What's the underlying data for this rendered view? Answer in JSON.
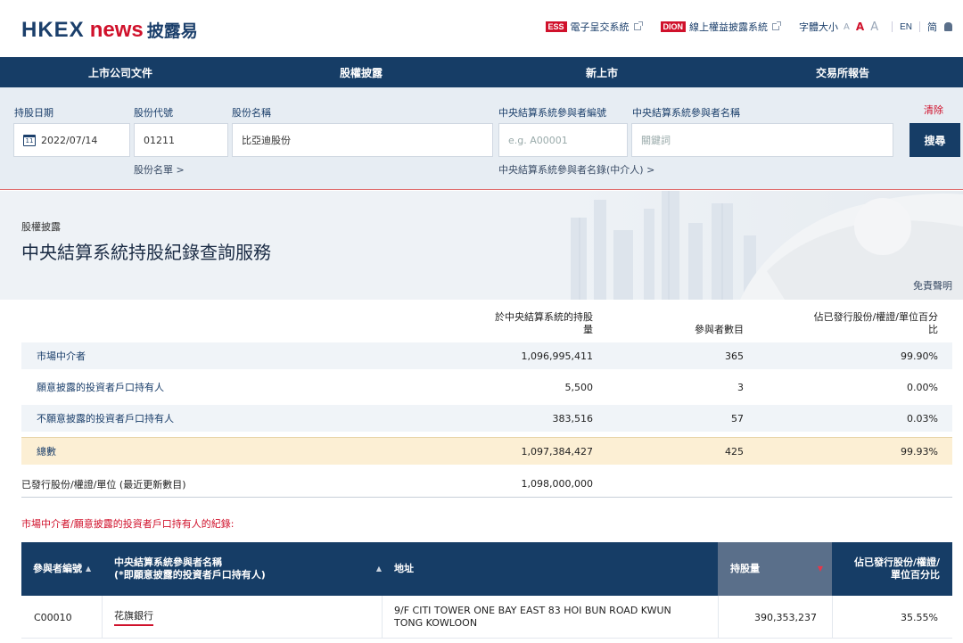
{
  "header": {
    "logo_hkex": "HKEX",
    "logo_news": "news",
    "logo_zh": "披露易",
    "ess_badge": "ESS",
    "ess_label": "電子呈交系統",
    "dion_badge": "DION",
    "dion_label": "線上權益披露系統",
    "font_size_label": "字體大小",
    "font_sizes": [
      "A",
      "A",
      "A"
    ],
    "lang_en": "EN",
    "lang_simplified": "简"
  },
  "nav": {
    "items": [
      "上市公司文件",
      "股權披露",
      "新上市",
      "交易所報告"
    ]
  },
  "search": {
    "date_label": "持股日期",
    "date_value": "2022/07/14",
    "code_label": "股份代號",
    "code_value": "01211",
    "name_label": "股份名稱",
    "name_value": "比亞迪股份",
    "participant_id_label": "中央結算系統參與者編號",
    "participant_id_placeholder": "e.g. A00001",
    "participant_name_label": "中央結算系統參與者名稱",
    "participant_name_placeholder": "關鍵詞",
    "clear_label": "清除",
    "search_button": "搜尋",
    "stock_list_link": "股份名單 >",
    "participant_list_link": "中央結算系統參與者名錄(中介人) >"
  },
  "hero": {
    "breadcrumb": "股權披露",
    "title": "中央結算系統持股紀錄查詢服務",
    "disclaimer": "免責聲明"
  },
  "summary": {
    "headers": {
      "qty_line1": "於中央結算系統的持股",
      "qty_line2": "量",
      "participants": "參與者數目",
      "pct_line1": "佔已發行股份/權證/單位百分",
      "pct_line2": "比"
    },
    "rows": [
      {
        "name": "市場中介者",
        "qty": "1,096,995,411",
        "participants": "365",
        "pct": "99.90%"
      },
      {
        "name": "願意披露的投資者戶口持有人",
        "qty": "5,500",
        "participants": "3",
        "pct": "0.00%"
      },
      {
        "name": "不願意披露的投資者戶口持有人",
        "qty": "383,516",
        "participants": "57",
        "pct": "0.03%"
      }
    ],
    "total": {
      "name": "總數",
      "qty": "1,097,384,427",
      "participants": "425",
      "pct": "99.93%"
    },
    "issued": {
      "name": "已發行股份/權證/單位 (最近更新數目)",
      "qty": "1,098,000,000"
    }
  },
  "records": {
    "heading": "市場中介者/願意披露的投資者戶口持有人的紀錄:",
    "headers": {
      "id": "參與者編號",
      "name_line1": "中央結算系統參與者名稱",
      "name_line2": "(*即願意披露的投資者戶口持有人)",
      "address": "地址",
      "holding": "持股量",
      "pct_line1": "佔已發行股份/權證/",
      "pct_line2": "單位百分比"
    },
    "rows": [
      {
        "id": "C00010",
        "name": "花旗銀行",
        "address_line1": "9/F CITI TOWER ONE BAY EAST 83 HOI BUN ROAD KWUN",
        "address_line2": "TONG KOWLOON",
        "holding": "390,353,237",
        "pct": "35.55%"
      }
    ]
  },
  "colors": {
    "brand_navy": "#163d66",
    "brand_red": "#d0112b",
    "total_row": "#fcefd4"
  }
}
